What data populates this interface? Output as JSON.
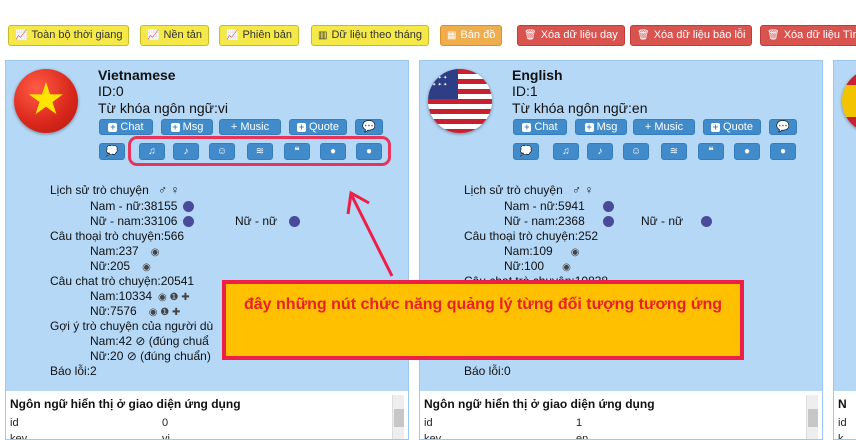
{
  "toolbar": {
    "buttons": [
      {
        "label": "Toàn bộ thời giang",
        "icon": "line-chart-icon",
        "style": "yellow"
      },
      {
        "label": "Nền tản",
        "icon": "line-chart-icon",
        "style": "yellow"
      },
      {
        "label": "Phiên bản",
        "icon": "line-chart-icon",
        "style": "yellow"
      },
      {
        "label": "Dữ liệu theo tháng",
        "icon": "bar-chart-icon",
        "style": "yellow"
      },
      {
        "label": "Bản đồ",
        "icon": "map-icon",
        "style": "orange"
      },
      {
        "label": "Xóa dữ liệu day",
        "icon": "trash-icon",
        "style": "red"
      },
      {
        "label": "Xóa dữ liệu báo lỗi",
        "icon": "trash-icon",
        "style": "red"
      },
      {
        "label": "Xóa dữ liệu Tìm",
        "icon": "trash-icon",
        "style": "red"
      }
    ]
  },
  "panels": [
    {
      "name": "Vietnamese",
      "id_line": "ID:0",
      "keyword_line": "Từ khóa ngôn ngữ:vi",
      "action_buttons": [
        "Chat",
        "Msg",
        "Music",
        "Quote"
      ],
      "stats": {
        "history_label": "Lịch sử trò chuyện",
        "gender_symbols": "♂ ♀",
        "male_female": "Nam - nữ:38155",
        "female_male": "Nữ - nam:33106",
        "female_female": "Nữ - nữ",
        "call_label": "Câu thoại trò chuyện:566",
        "call_male": "Nam:237",
        "call_female": "Nữ:205",
        "chat_label": "Câu chat trò chuyện:20541",
        "chat_male": "Nam:10334",
        "chat_female": "Nữ:7576",
        "suggest_label": "Gợi ý trò chuyện của người dù",
        "suggest_male": "Nam:42 ⊘ (đúng chuẩ",
        "suggest_female": "Nữ:20 ⊘ (đúng chuẩn)",
        "error_label": "Báo lỗi:2"
      },
      "table": {
        "title": "Ngôn ngữ hiển thị ở giao diện ứng dụng",
        "row1_key": "id",
        "row1_val": "0",
        "row2_key": "key",
        "row2_val": "vi"
      }
    },
    {
      "name": "English",
      "id_line": "ID:1",
      "keyword_line": "Từ khóa ngôn ngữ:en",
      "action_buttons": [
        "Chat",
        "Msg",
        "Music",
        "Quote"
      ],
      "stats": {
        "history_label": "Lịch sử trò chuyện",
        "gender_symbols": "♂ ♀",
        "male_female": "Nam - nữ:5941",
        "female_male": "Nữ - nam:2368",
        "female_female": "Nữ - nữ",
        "call_label": "Câu thoại trò chuyện:252",
        "call_male": "Nam:109",
        "call_female": "Nữ:100",
        "chat_label": "Câu chat trò chuyện:10838",
        "error_label": "Báo lỗi:0"
      },
      "table": {
        "title": "Ngôn ngữ hiển thị ở giao diện ứng dụng",
        "row1_key": "id",
        "row1_val": "1",
        "row2_key": "key",
        "row2_val": "en"
      }
    },
    {
      "table": {
        "title": "N",
        "row1_key": "id",
        "row2_key": "k"
      }
    }
  ],
  "annotation": {
    "text": "đây những nút chức năng quảng lý từng đối tượng tương ứng"
  },
  "colors": {
    "panel_bg": "#b5d8f7",
    "button_blue": "#428bca",
    "highlight": "#e8345a",
    "note_bg": "#ffc000"
  }
}
